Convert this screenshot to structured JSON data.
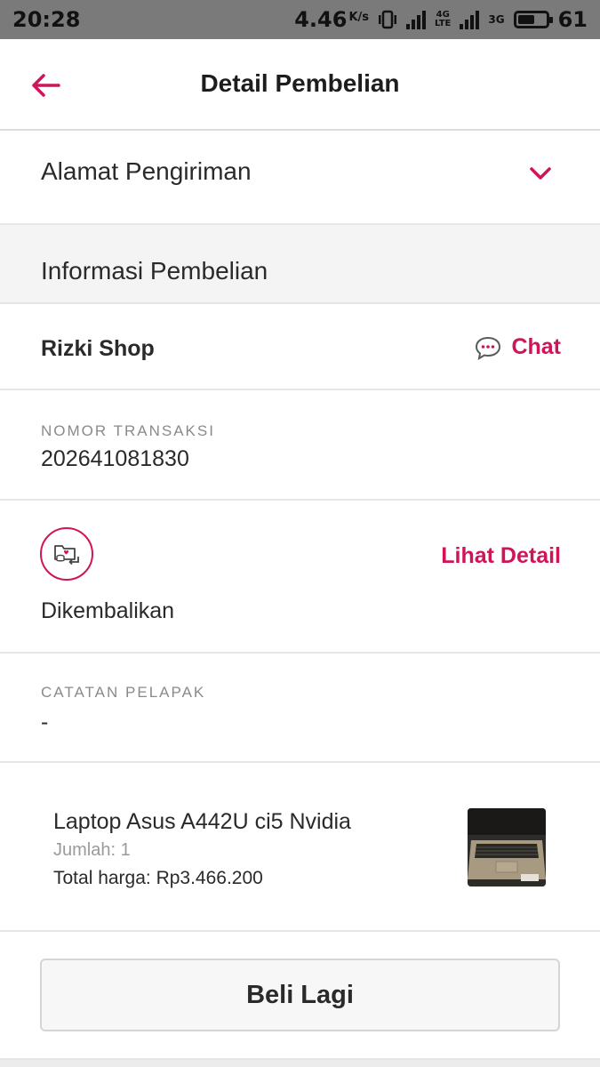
{
  "status_bar": {
    "time": "20:28",
    "speed": "4.46",
    "speed_unit": "K/s",
    "net_4g": "4G",
    "net_lte": "LTE",
    "net_3g": "3G",
    "battery_percent": "61",
    "battery_level": 0.61
  },
  "header": {
    "title": "Detail Pembelian",
    "back_icon": "arrow-left-icon"
  },
  "shipping": {
    "label": "Alamat Pengiriman",
    "expand_icon": "chevron-down-icon"
  },
  "purchase_info": {
    "heading": "Informasi Pembelian"
  },
  "shop": {
    "name": "Rizki Shop",
    "chat_label": "Chat",
    "chat_icon": "chat-bubble-icon"
  },
  "transaction": {
    "caption": "NOMOR TRANSAKSI",
    "number": "202641081830"
  },
  "order_status": {
    "icon": "return-package-icon",
    "detail_link": "Lihat Detail",
    "status_text": "Dikembalikan"
  },
  "seller_note": {
    "caption": "CATATAN PELAPAK",
    "note": "-"
  },
  "product": {
    "name": "Laptop Asus A442U ci5 Nvidia",
    "quantity": "Jumlah: 1",
    "total": "Total harga: Rp3.466.200",
    "thumbnail_icon": "laptop-thumbnail"
  },
  "actions": {
    "buy_again": "Beli Lagi"
  },
  "colors": {
    "accent": "#d0145a",
    "status_bar": "#7a7a7a",
    "section_bg": "#f4f4f4"
  }
}
